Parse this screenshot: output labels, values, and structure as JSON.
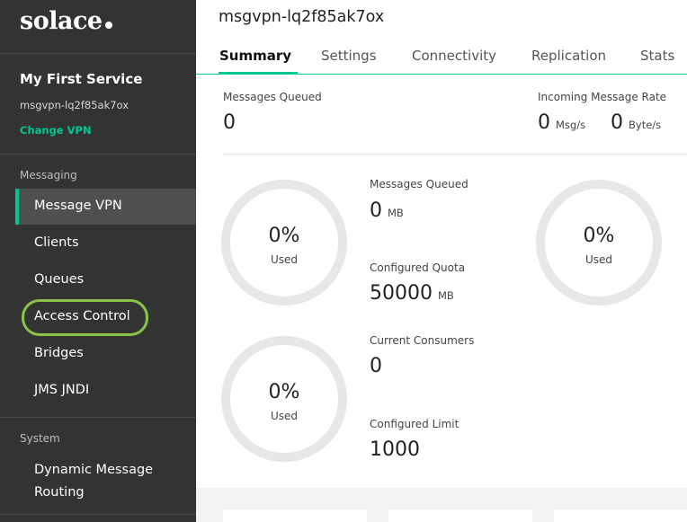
{
  "brand": {
    "logo_text": "solace"
  },
  "service": {
    "name": "My First Service",
    "vpn": "msgvpn-lq2f85ak7ox",
    "change_vpn_label": "Change VPN"
  },
  "sidebar": {
    "messaging_label": "Messaging",
    "messaging_items": [
      {
        "label": "Message VPN"
      },
      {
        "label": "Clients"
      },
      {
        "label": "Queues"
      },
      {
        "label": "Access Control"
      },
      {
        "label": "Bridges"
      },
      {
        "label": "JMS JNDI"
      }
    ],
    "system_label": "System",
    "system_items": [
      {
        "label_line1": "Dynamic Message",
        "label_line2": "Routing"
      }
    ],
    "active_item": "Message VPN",
    "highlighted_item": "Access Control",
    "accent_color": "#00c895",
    "highlight_color": "#8bc34a"
  },
  "header": {
    "title": "msgvpn-lq2f85ak7ox",
    "tabs": [
      {
        "label": "Summary"
      },
      {
        "label": "Settings"
      },
      {
        "label": "Connectivity"
      },
      {
        "label": "Replication"
      },
      {
        "label": "Stats"
      }
    ],
    "active_tab": "Summary"
  },
  "summary": {
    "messages_queued_label": "Messages Queued",
    "messages_queued_value": "0",
    "incoming_rate_label": "Incoming Message Rate",
    "incoming_msg_value": "0",
    "incoming_msg_unit": "Msg/s",
    "incoming_byte_value": "0",
    "incoming_byte_unit": "Byte/s"
  },
  "gauges": {
    "storage": {
      "percent_label": "0%",
      "used_label": "Used",
      "used_fraction": 0,
      "queued_label": "Messages Queued",
      "queued_value": "0",
      "queued_unit": "MB",
      "quota_label": "Configured Quota",
      "quota_value": "50000",
      "quota_unit": "MB"
    },
    "second": {
      "percent_label": "0%",
      "used_label": "Used",
      "used_fraction": 0
    },
    "consumers": {
      "percent_label": "0%",
      "used_label": "Used",
      "used_fraction": 0,
      "current_label": "Current Consumers",
      "current_value": "0",
      "limit_label": "Configured Limit",
      "limit_value": "1000"
    }
  }
}
